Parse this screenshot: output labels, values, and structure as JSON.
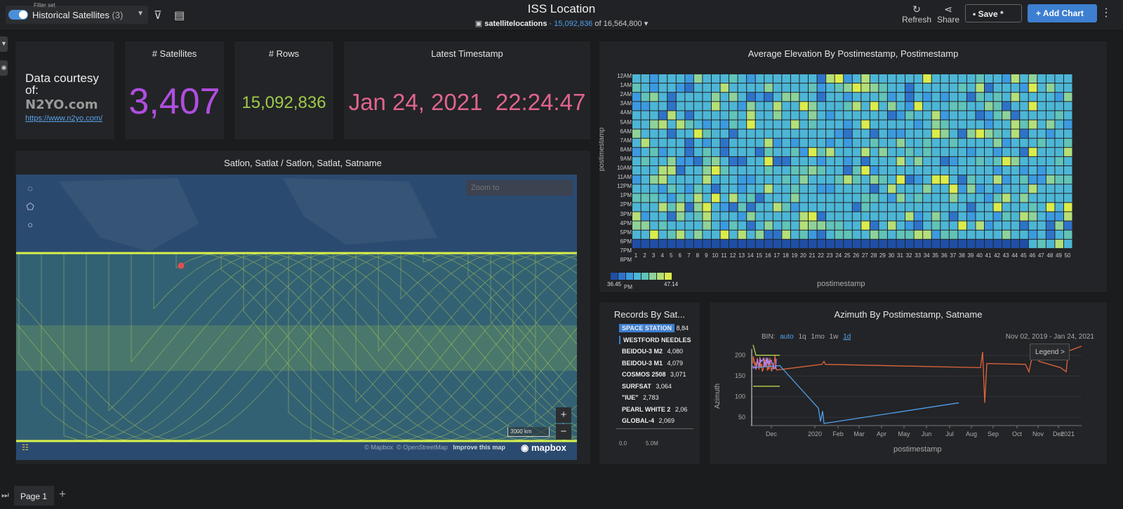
{
  "header": {
    "filter_set_label": "Filter set",
    "filter_set_name": "Historical Satellites",
    "filter_set_count": "(3)",
    "title": "ISS Location",
    "datasource": "satellitelocations",
    "row_filtered": "15,092,836",
    "row_of": "of 16,564,800",
    "refresh_label": "Refresh",
    "share_label": "Share",
    "save_label": "Save *",
    "add_chart_label": "Add Chart"
  },
  "kpis": {
    "courtesy_text": "Data courtesy of:",
    "courtesy_logo": "N2YO.com",
    "courtesy_link": "https://www.n2yo.com/",
    "satellites_title": "# Satellites",
    "satellites_value": "3,407",
    "rows_title": "# Rows",
    "rows_value": "15,092,836",
    "latest_title": "Latest Timestamp",
    "latest_value": "Jan 24, 2021  22:24:47"
  },
  "map": {
    "title": "Satlon, Satlat / Satlon, Satlat, Satname",
    "zoom_to_placeholder": "Zoom to",
    "scale_label": "3000 km",
    "attrib_mapbox": "© Mapbox",
    "attrib_osm": "© OpenStreetMap",
    "attrib_improve": "Improve this map",
    "brand": "mapbox",
    "colors": {
      "ocean": "#2b4a70",
      "track": "#d8f04a",
      "point": "#e05050"
    }
  },
  "heatmap": {
    "title": "Average Elevation By Postimestamp, Postimestamp",
    "y_labels": [
      "12AM",
      "1AM",
      "2AM",
      "3AM",
      "4AM",
      "5AM",
      "6AM",
      "7AM",
      "8AM",
      "9AM",
      "10AM",
      "11AM",
      "12PM",
      "1PM",
      "2PM",
      "3PM",
      "4PM",
      "5PM",
      "6PM",
      "7PM",
      "8PM"
    ],
    "x_labels": [
      "1",
      "2",
      "3",
      "4",
      "5",
      "6",
      "7",
      "8",
      "9",
      "10",
      "11",
      "12",
      "13",
      "14",
      "15",
      "16",
      "17",
      "18",
      "19",
      "20",
      "21",
      "22",
      "23",
      "24",
      "25",
      "26",
      "27",
      "28",
      "29",
      "30",
      "31",
      "32",
      "33",
      "34",
      "35",
      "36",
      "37",
      "38",
      "39",
      "40",
      "41",
      "42",
      "43",
      "44",
      "45",
      "46",
      "47",
      "48",
      "49",
      "50"
    ],
    "y_axis_label": "postimestamp",
    "x_axis_label": "postimestamp",
    "legend_min": "36.45",
    "legend_pm": "PM",
    "legend_max": "47.14",
    "colors": [
      "#1f4fa5",
      "#2e73c9",
      "#3b9ae0",
      "#4db6d6",
      "#62c3b8",
      "#8ed29a",
      "#b5df78",
      "#dbec4c"
    ]
  },
  "records": {
    "title": "Records By Sat...",
    "items": [
      {
        "name": "SPACE STATION",
        "value": "8,84"
      },
      {
        "name": "WESTFORD NEEDLES",
        "value": ""
      },
      {
        "name": "BEIDOU-3 M2",
        "value": "4,080"
      },
      {
        "name": "BEIDOU-3 M1",
        "value": "4,079"
      },
      {
        "name": "COSMOS 2508",
        "value": "3,071"
      },
      {
        "name": "SURFSAT",
        "value": "3,064"
      },
      {
        "name": "\"IUE\"",
        "value": "2,783"
      },
      {
        "name": "PEARL WHITE 2",
        "value": "2,06"
      },
      {
        "name": "GLOBAL-4",
        "value": "2,069"
      }
    ],
    "x_ticks": [
      "0.0",
      "5.0M"
    ],
    "bar_color": "#3d7fd1"
  },
  "azimuth": {
    "title": "Azimuth By Postimestamp, Satname",
    "bin_label": "BIN:",
    "bins": [
      "auto",
      "1q",
      "1mo",
      "1w",
      "1d"
    ],
    "range": "Nov 02, 2019 - Jan 24, 2021",
    "legend_button": "Legend >",
    "y_axis_label": "Azimuth",
    "x_axis_label": "postimestamp",
    "y_ticks": [
      "200",
      "150",
      "100",
      "50"
    ],
    "x_ticks": [
      "Dec",
      "2020",
      "Feb",
      "Mar",
      "Apr",
      "May",
      "Jun",
      "Jul",
      "Aug",
      "Sep",
      "Oct",
      "Nov",
      "Dec",
      "2021"
    ]
  },
  "footer": {
    "page_tab": "Page 1",
    "add_page": "+"
  }
}
